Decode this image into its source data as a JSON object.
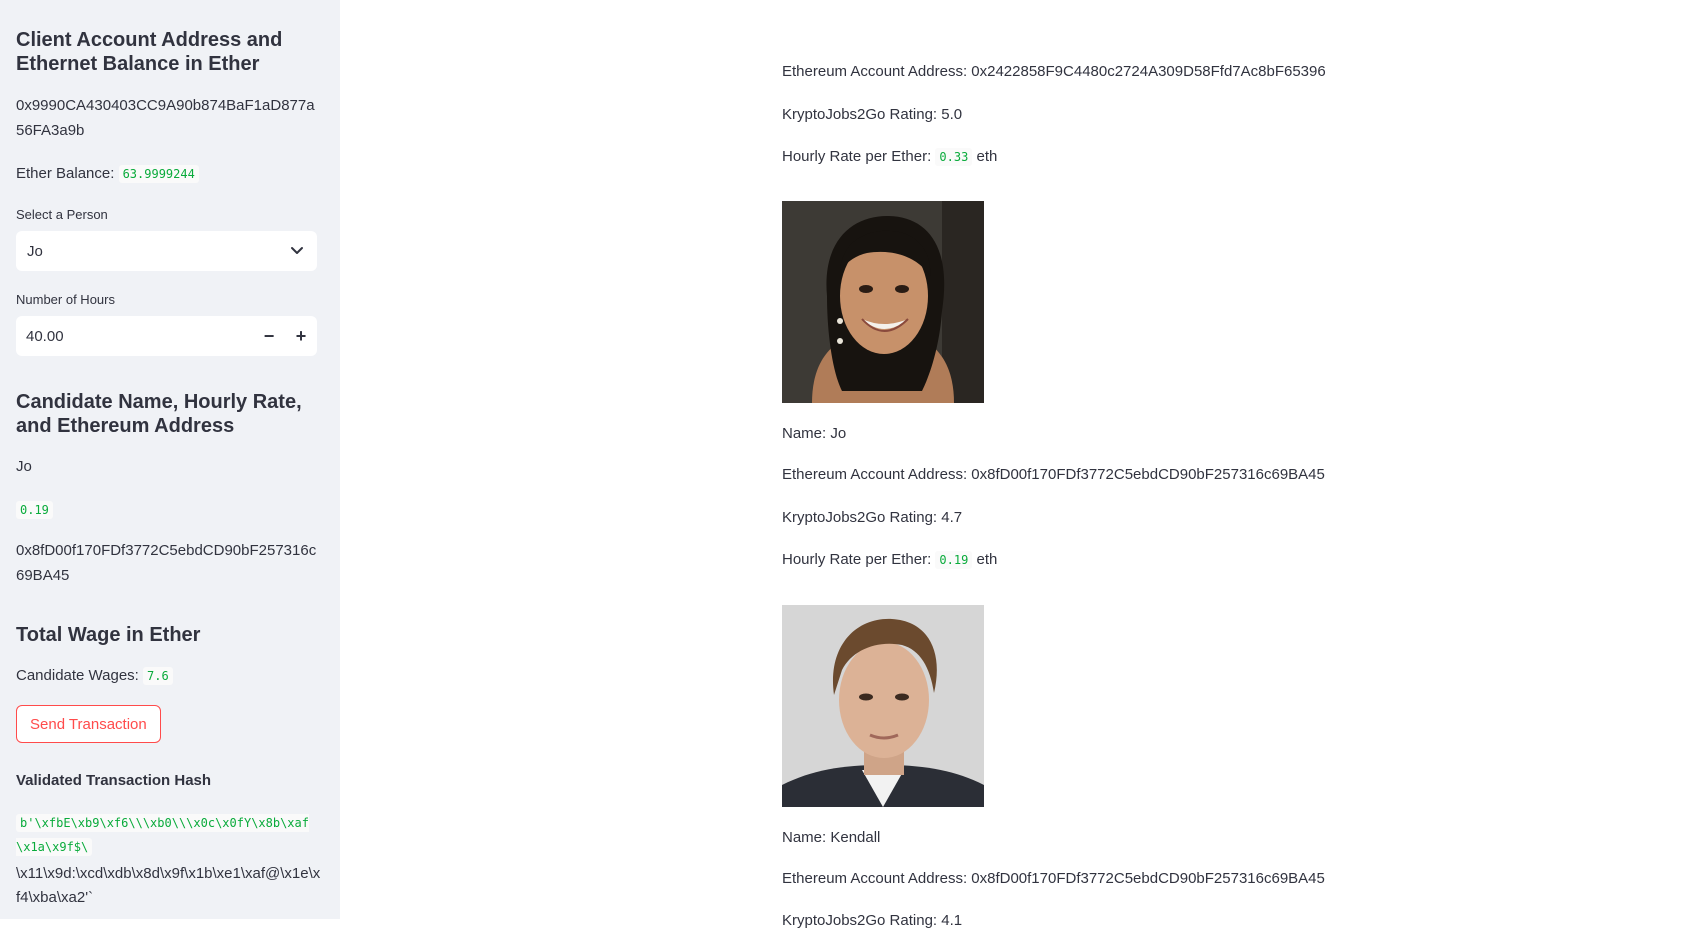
{
  "sidebar": {
    "client_heading": "Client Account Address and Ethernet Balance in Ether",
    "client_address": "0x9990CA430403CC9A90b874BaF1aD877a56FA3a9b",
    "ether_balance_label": "Ether Balance:",
    "ether_balance_value": "63.9999244",
    "select_person_label": "Select a Person",
    "select_person_value": "Jo",
    "hours_label": "Number of Hours",
    "hours_value": "40.00",
    "hours_minus": "−",
    "hours_plus": "+",
    "candidate_heading": "Candidate Name, Hourly Rate, and Ethereum Address",
    "candidate_name": "Jo",
    "candidate_rate": "0.19",
    "candidate_address": "0x8fD00f170FDf3772C5ebdCD90bF257316c69BA45",
    "wage_heading": "Total Wage in Ether",
    "wages_label": "Candidate Wages:",
    "wages_value": "7.6",
    "send_button": "Send Transaction",
    "hash_heading": "Validated Transaction Hash",
    "hash_code": "b'\\xfbE\\xb9\\xf6\\\\\\xb0\\\\\\x0c\\x0fY\\x8b\\xaf\\x1a\\x9f$\\",
    "hash_rest": "\\x11\\x9d:\\xcd\\xdb\\x8d\\x9f\\x1b\\xe1\\xaf@\\x1e\\xf4\\xba\\xa2'`"
  },
  "main": {
    "top_address": "Ethereum Account Address: 0x2422858F9C4480c2724A309D58Ffd7Ac8bF65396",
    "top_rating": "KryptoJobs2Go Rating: 5.0",
    "top_rate_label": "Hourly Rate per Ether:",
    "top_rate_value": "0.33",
    "top_rate_unit": "eth",
    "jo_name": "Name: Jo",
    "jo_address": "Ethereum Account Address: 0x8fD00f170FDf3772C5ebdCD90bF257316c69BA45",
    "jo_rating": "KryptoJobs2Go Rating: 4.7",
    "jo_rate_label": "Hourly Rate per Ether:",
    "jo_rate_value": "0.19",
    "jo_rate_unit": "eth",
    "kendall_name": "Name: Kendall",
    "kendall_address": "Ethereum Account Address: 0x8fD00f170FDf3772C5ebdCD90bF257316c69BA45",
    "kendall_rating": "KryptoJobs2Go Rating: 4.1"
  },
  "colors": {
    "accent": "#ff4b4b",
    "code_green": "#09ab3b",
    "sidebar_bg": "#f0f2f6"
  }
}
